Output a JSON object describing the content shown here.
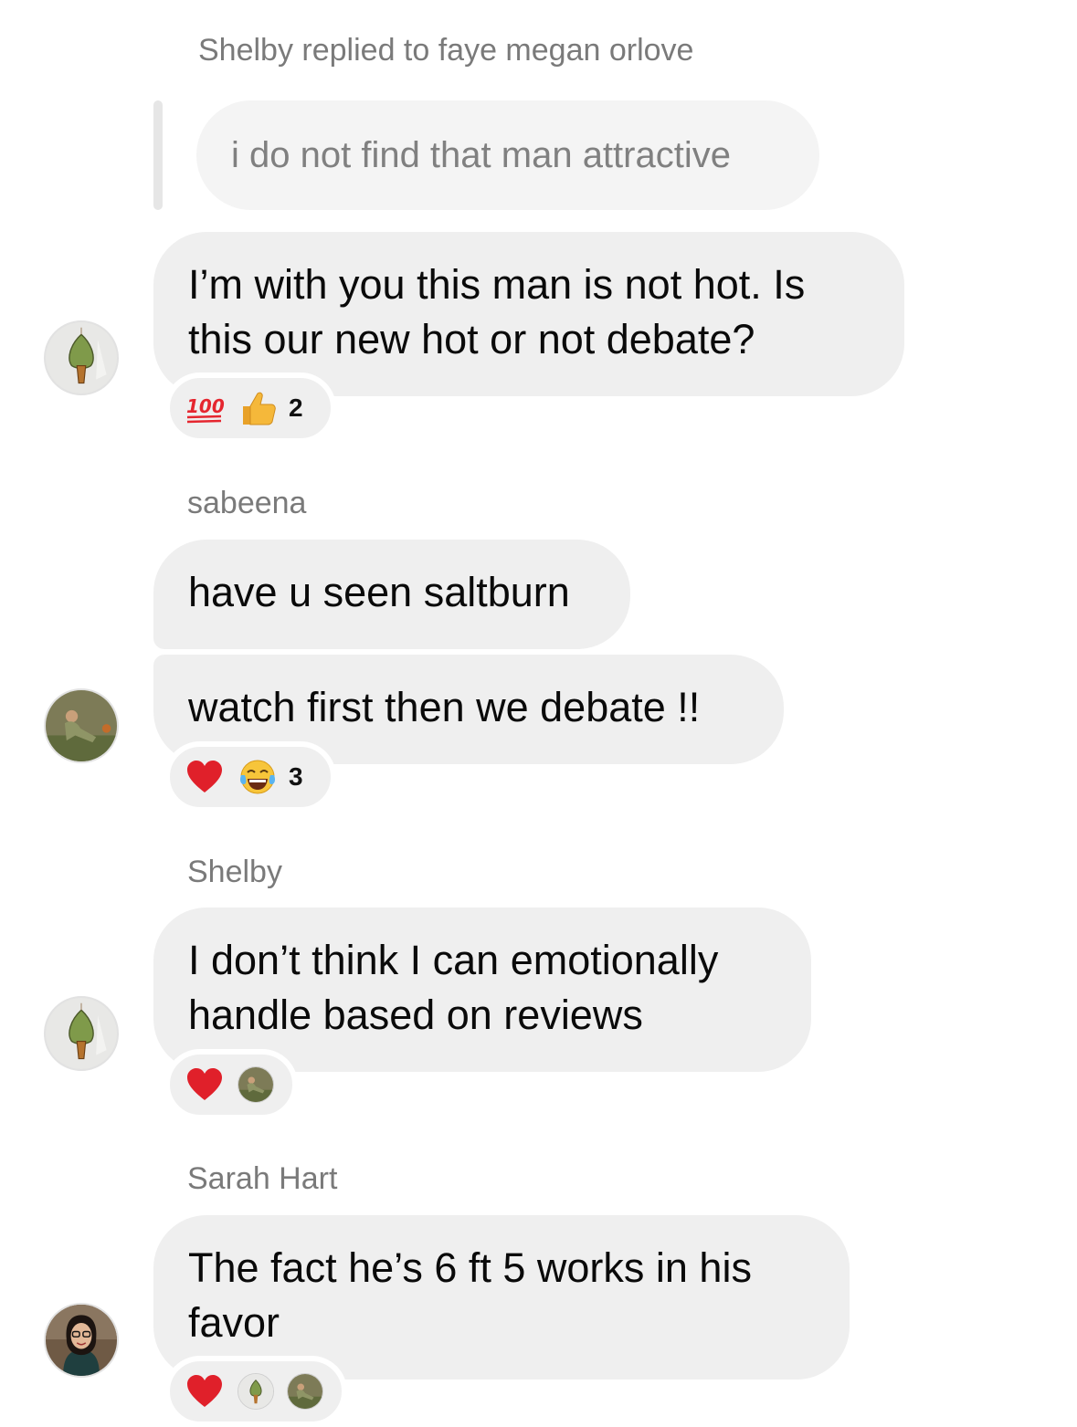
{
  "thread": {
    "reply_context": {
      "label": "Shelby replied to faye megan orlove",
      "quoted_text": "i do not find that man attractive"
    },
    "messages": [
      {
        "bubbles": [
          "I’m with you this man is not hot. Is this our new hot or not debate?"
        ],
        "avatar_icon": "mushroom-avatar-icon",
        "reactions": {
          "emojis": [
            "💯",
            "👍"
          ],
          "count": "2"
        }
      },
      {
        "sender": "sabeena",
        "bubbles": [
          "have u seen saltburn",
          "watch first then we debate !!"
        ],
        "avatar_icon": "portrait-green-avatar-icon",
        "reactions": {
          "emojis": [
            "❤️",
            "😂"
          ],
          "count": "3"
        }
      },
      {
        "sender": "Shelby",
        "bubbles": [
          "I don’t think I can emotionally handle based on reviews"
        ],
        "avatar_icon": "mushroom-avatar-icon",
        "reactions": {
          "emojis": [
            "❤️"
          ],
          "reactor_avatars": [
            "portrait-green-avatar-icon"
          ]
        }
      },
      {
        "sender": "Sarah Hart",
        "bubbles": [
          "The fact he’s 6 ft 5 works in his favor"
        ],
        "avatar_icon": "glasses-woman-avatar-icon",
        "reactions": {
          "emojis": [
            "❤️"
          ],
          "reactor_avatars": [
            "mushroom-avatar-icon",
            "portrait-green-avatar-icon"
          ]
        }
      }
    ]
  },
  "colors": {
    "bubble_bg": "#efefef",
    "reply_bubble_bg": "#f4f4f4",
    "meta_text": "#7a7a7a",
    "heart": "#e0202a",
    "hundred": "#e5262f",
    "thumbs_up": "#f5b83a"
  }
}
